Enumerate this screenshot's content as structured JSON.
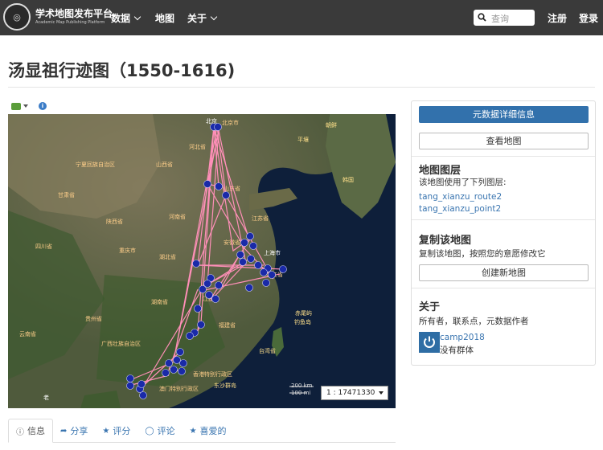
{
  "nav": {
    "brand_title": "学术地图发布平台",
    "brand_subtitle": "Academic Map Publishing Platform",
    "items": [
      {
        "label": "数据"
      },
      {
        "label": "地图"
      },
      {
        "label": "关于"
      }
    ],
    "search_placeholder": "查询",
    "register": "注册",
    "login": "登录"
  },
  "page": {
    "title": "汤显祖行迹图（1550-1616)"
  },
  "map": {
    "scale": "1 : 17471330",
    "scale_bar_km": "200 km",
    "scale_bar_mi": "100 mi",
    "labels": {
      "beijing": "北京",
      "beijing_city": "北京市",
      "chaoxian": "朝鲜",
      "pingrang": "平壤",
      "hanguo": "韩国",
      "hebei": "河北省",
      "shanxi": "山西省",
      "shandong": "山东省",
      "gansu": "甘肃省",
      "shaanxi": "陕西省",
      "henan": "河南省",
      "sichuan": "四川省",
      "chongqing": "重庆市",
      "hubei": "湖北省",
      "anhui": "安徽省",
      "jiangsu": "江苏省",
      "shanghai": "上海市",
      "zhejiang": "浙江省",
      "hunan": "湖南省",
      "jiangxi": "江西省",
      "fujian": "福建省",
      "guizhou": "贵州省",
      "yunnan": "云南省",
      "guangxi": "广西壮族自治区",
      "hongkong": "香港特别行政区",
      "macau": "澳门特别行政区",
      "taiwan": "台湾省",
      "chiwei": "赤尾屿",
      "diaoyu": "钓鱼岛",
      "dongsha": "东沙群岛",
      "ningxia": "宁夏回族自治区",
      "laos": "老",
      "tianjin": "天"
    }
  },
  "tabs": [
    {
      "icon": "info-icon",
      "label": "信息"
    },
    {
      "icon": "share-icon",
      "label": "分享"
    },
    {
      "icon": "star-icon",
      "label": "评分"
    },
    {
      "icon": "comment-icon",
      "label": "评论"
    },
    {
      "icon": "star-icon",
      "label": "喜爱的"
    }
  ],
  "sidebar": {
    "metadata_button": "元数据详细信息",
    "view_map_button": "查看地图",
    "layers_title": "地图图层",
    "layers_text": "该地图使用了下列图层:",
    "layers": [
      "tang_xianzu_route2",
      "tang_xianzu_point2"
    ],
    "copy_title": "复制该地图",
    "copy_text": "复制该地图，按照您的意愿修改它",
    "create_button": "创建新地图",
    "about_title": "关于",
    "about_text": "所有者，联系点，元数据作者",
    "owner_name": "camp2018",
    "owner_group": "没有群体"
  },
  "colors": {
    "navbar": "#3a3a3a",
    "primary": "#3271ac",
    "link": "#3a75b0",
    "route": "#ff8fb8",
    "point": "#1a2aa8"
  }
}
